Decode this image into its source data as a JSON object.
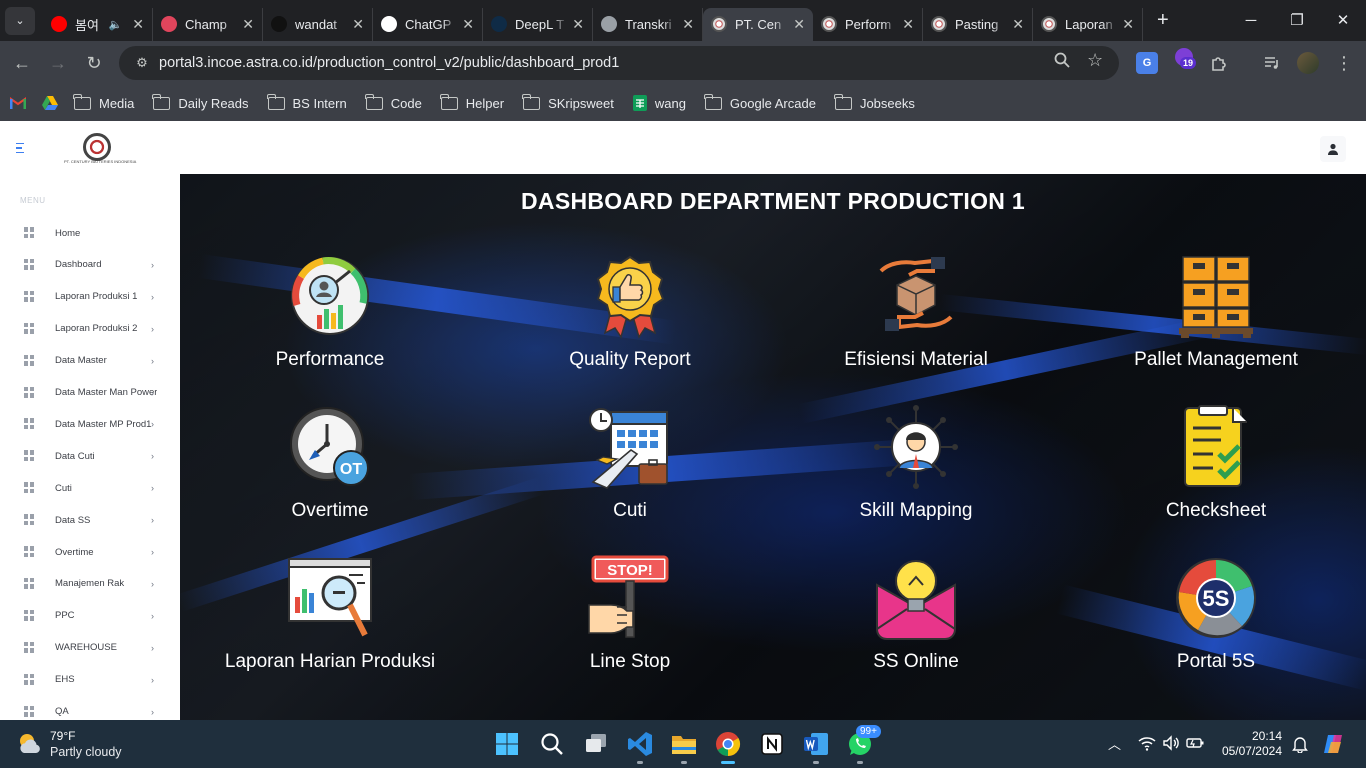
{
  "browser": {
    "tabs": [
      {
        "title": "봄여",
        "favicon": "youtube-icon",
        "color": "#ff0000",
        "sound": true
      },
      {
        "title": "Champ",
        "favicon": "triangle-logo-icon",
        "color": "#e0455c"
      },
      {
        "title": "wandat",
        "favicon": "w-logo-icon",
        "color": "#111111"
      },
      {
        "title": "ChatGP",
        "favicon": "openai-icon",
        "color": "#ffffff"
      },
      {
        "title": "DeepL T",
        "favicon": "deepl-icon",
        "color": "#0f2b46"
      },
      {
        "title": "Transkri",
        "favicon": "globe-icon",
        "color": "#9aa0a6"
      },
      {
        "title": "PT. Cen",
        "favicon": "company-seal-icon",
        "color": "#cccccc",
        "active": true
      },
      {
        "title": "Perform",
        "favicon": "company-seal-icon",
        "color": "#cccccc"
      },
      {
        "title": "Pasting",
        "favicon": "company-seal-icon",
        "color": "#cccccc"
      },
      {
        "title": "Laporan",
        "favicon": "company-seal-icon",
        "color": "#cccccc"
      }
    ],
    "url": "portal3.incoe.astra.co.id/production_control_v2/public/dashboard_prod1",
    "extension_badge": "19",
    "bookmarks": [
      {
        "label": "",
        "icon": "gmail-icon"
      },
      {
        "label": "",
        "icon": "google-drive-icon"
      },
      {
        "label": "Media",
        "icon": "folder-icon"
      },
      {
        "label": "Daily Reads",
        "icon": "folder-icon"
      },
      {
        "label": "BS Intern",
        "icon": "folder-icon"
      },
      {
        "label": "Code",
        "icon": "folder-icon"
      },
      {
        "label": "Helper",
        "icon": "folder-icon"
      },
      {
        "label": "SKripsweet",
        "icon": "folder-icon"
      },
      {
        "label": "wang",
        "icon": "sheets-icon"
      },
      {
        "label": "Google Arcade",
        "icon": "folder-icon"
      },
      {
        "label": "Jobseeks",
        "icon": "folder-icon"
      }
    ]
  },
  "sidebar": {
    "company": "PT. CENTURY BATTERIES INDONESIA",
    "menu_label": "MENU",
    "items": [
      {
        "label": "Home",
        "chevron": false
      },
      {
        "label": "Dashboard",
        "chevron": true
      },
      {
        "label": "Laporan Produksi 1",
        "chevron": true
      },
      {
        "label": "Laporan Produksi 2",
        "chevron": true
      },
      {
        "label": "Data Master",
        "chevron": true
      },
      {
        "label": "Data Master Man Power",
        "chevron": true
      },
      {
        "label": "Data Master MP Prod1",
        "chevron": true
      },
      {
        "label": "Data Cuti",
        "chevron": true
      },
      {
        "label": "Cuti",
        "chevron": true
      },
      {
        "label": "Data SS",
        "chevron": true
      },
      {
        "label": "Overtime",
        "chevron": true
      },
      {
        "label": "Manajemen Rak",
        "chevron": true
      },
      {
        "label": "PPC",
        "chevron": true
      },
      {
        "label": "WAREHOUSE",
        "chevron": true
      },
      {
        "label": "EHS",
        "chevron": true
      },
      {
        "label": "QA",
        "chevron": true
      }
    ]
  },
  "dashboard": {
    "title": "DASHBOARD DEPARTMENT PRODUCTION 1",
    "tiles": [
      {
        "label": "Performance",
        "icon": "performance-gauge-icon"
      },
      {
        "label": "Quality Report",
        "icon": "quality-badge-icon"
      },
      {
        "label": "Efisiensi Material",
        "icon": "material-hands-box-icon"
      },
      {
        "label": "Pallet Management",
        "icon": "pallet-boxes-icon"
      },
      {
        "label": "Overtime",
        "icon": "overtime-clock-icon",
        "icon_text": "OT"
      },
      {
        "label": "Cuti",
        "icon": "leave-calendar-plane-icon"
      },
      {
        "label": "Skill Mapping",
        "icon": "skill-mapping-person-icon"
      },
      {
        "label": "Checksheet",
        "icon": "checksheet-clipboard-icon"
      },
      {
        "label": "Laporan Harian Produksi",
        "icon": "daily-report-magnifier-icon"
      },
      {
        "label": "Line Stop",
        "icon": "line-stop-sign-icon",
        "icon_text": "STOP!"
      },
      {
        "label": "SS Online",
        "icon": "ss-lightbulb-icon"
      },
      {
        "label": "Portal 5S",
        "icon": "portal-5s-wheel-icon",
        "icon_text": "5S"
      }
    ]
  },
  "taskbar": {
    "weather_temp": "79°F",
    "weather_cond": "Partly cloudy",
    "whatsapp_badge": "99+",
    "time": "20:14",
    "date": "05/07/2024"
  }
}
